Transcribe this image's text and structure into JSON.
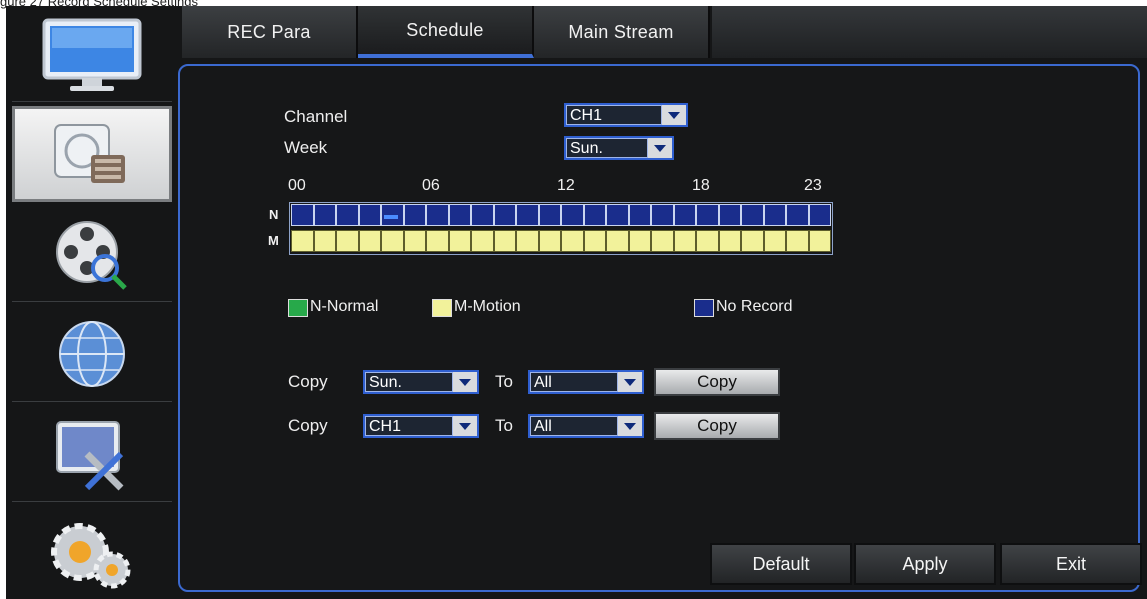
{
  "caption": "gure 27 Record Schedule Settings",
  "tabs": [
    {
      "label": "REC Para",
      "active": false
    },
    {
      "label": "Schedule",
      "active": true
    },
    {
      "label": "Main Stream",
      "active": false
    }
  ],
  "sidebar": {
    "items": [
      {
        "icon": "monitor-icon",
        "active": false
      },
      {
        "icon": "record-icon",
        "active": true
      },
      {
        "icon": "playback-reel-icon",
        "active": false
      },
      {
        "icon": "network-globe-icon",
        "active": false
      },
      {
        "icon": "tools-icon",
        "active": false
      },
      {
        "icon": "gears-icon",
        "active": false
      }
    ]
  },
  "form": {
    "channel_label": "Channel",
    "channel_value": "CH1",
    "week_label": "Week",
    "week_value": "Sun."
  },
  "schedule": {
    "hour_labels": [
      "00",
      "06",
      "12",
      "18",
      "23"
    ],
    "row_n_label": "N",
    "row_m_label": "M",
    "hours": 24,
    "row_n": "No Record (all hours)",
    "row_m": "Motion (all hours)"
  },
  "legend": {
    "normal_label": "N-Normal",
    "motion_label": "M-Motion",
    "norecord_label": "No Record",
    "colors": {
      "normal": "#27a94a",
      "motion": "#f2f29b",
      "norecord": "#1a2d8c"
    }
  },
  "copy_rows": [
    {
      "copy_label": "Copy",
      "from_value": "Sun.",
      "to_label": "To",
      "to_value": "All",
      "button_label": "Copy"
    },
    {
      "copy_label": "Copy",
      "from_value": "CH1",
      "to_label": "To",
      "to_value": "All",
      "button_label": "Copy"
    }
  ],
  "footer": {
    "default_label": "Default",
    "apply_label": "Apply",
    "exit_label": "Exit"
  },
  "colors": {
    "accent": "#3b69cf",
    "background": "#151617"
  }
}
